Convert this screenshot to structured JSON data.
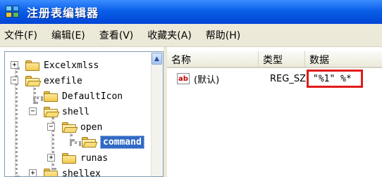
{
  "window": {
    "title": "注册表编辑器"
  },
  "menu": [
    "文件(F)",
    "编辑(E)",
    "查看(V)",
    "收藏夹(A)",
    "帮助(H)"
  ],
  "tree": {
    "items": [
      {
        "label": "Excelxmlss",
        "expander": "+"
      },
      {
        "label": "exefile",
        "expander": "−"
      },
      {
        "label": "DefaultIcon",
        "expander": ""
      },
      {
        "label": "shell",
        "expander": "−"
      },
      {
        "label": "open",
        "expander": "−"
      },
      {
        "label": "command",
        "expander": "",
        "selected": true
      },
      {
        "label": "runas",
        "expander": "+"
      },
      {
        "label": "shellex",
        "expander": "+"
      }
    ],
    "scroll_up_glyph": "▲"
  },
  "list": {
    "columns": [
      "名称",
      "类型",
      "数据"
    ],
    "rows": [
      {
        "icon_text": "ab",
        "name": "(默认)",
        "type": "REG_SZ",
        "data": "\"%1\" %*"
      }
    ]
  },
  "colors": {
    "title_bar": "#0a5fe8",
    "menu_bg": "#ece9d8",
    "selection": "#316ac5",
    "highlight_box": "#e01b1b"
  }
}
